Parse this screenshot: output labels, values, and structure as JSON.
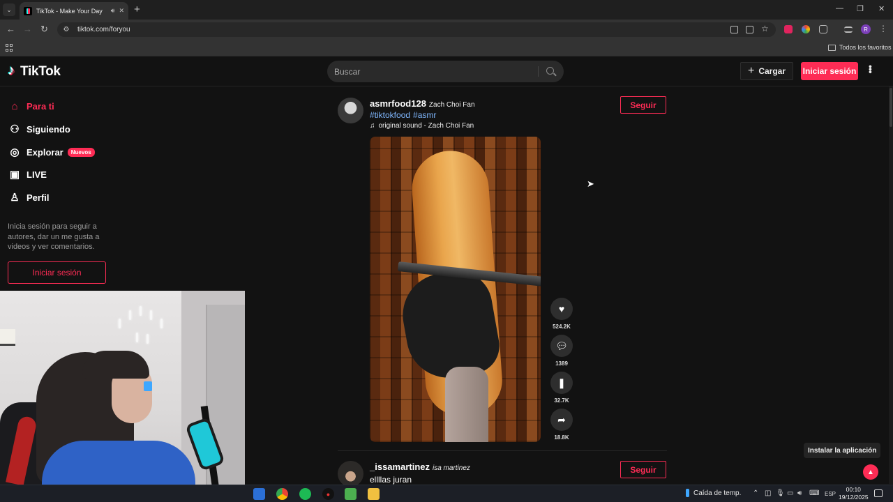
{
  "browser": {
    "tab_title": "TikTok - Make Your Day",
    "url": "tiktok.com/foryou",
    "bookmarks_folder": "Todos los favoritos"
  },
  "header": {
    "logo_text": "TikTok",
    "search_placeholder": "Buscar",
    "upload_label": "Cargar",
    "login_label": "Iniciar sesión"
  },
  "sidebar": {
    "items": [
      {
        "label": "Para ti",
        "icon": "home-icon",
        "active": true
      },
      {
        "label": "Siguiendo",
        "icon": "users-icon"
      },
      {
        "label": "Explorar",
        "icon": "compass-icon",
        "badge": "Nuevos"
      },
      {
        "label": "LIVE",
        "icon": "live-icon"
      },
      {
        "label": "Perfil",
        "icon": "user-icon"
      }
    ],
    "hint": "Inicia sesión para seguir a autores, dar un me gusta a videos y ver comentarios.",
    "login_label": "Iniciar sesión"
  },
  "feed": {
    "posts": [
      {
        "username": "asmrfood128",
        "nickname": "Zach Choi Fan",
        "hashtags": [
          "#tiktokfood",
          "#asmr"
        ],
        "sound": "original sound - Zach Choi Fan",
        "follow_label": "Seguir",
        "likes": "524.2K",
        "comments": "1389",
        "saves": "32.7K",
        "shares": "18.8K"
      },
      {
        "username": "_issamartinez",
        "nickname": "isa martinez",
        "description": "ellllas juran",
        "follow_label": "Seguir"
      }
    ]
  },
  "install_label": "Instalar la aplicación",
  "taskbar": {
    "weather": "Caída de temp.",
    "lang": "ESP",
    "time": "00:10",
    "date": "19/12/2025"
  },
  "colors": {
    "accent": "#fe2c55",
    "hashtag": "#80b8ff",
    "background": "#121212"
  }
}
